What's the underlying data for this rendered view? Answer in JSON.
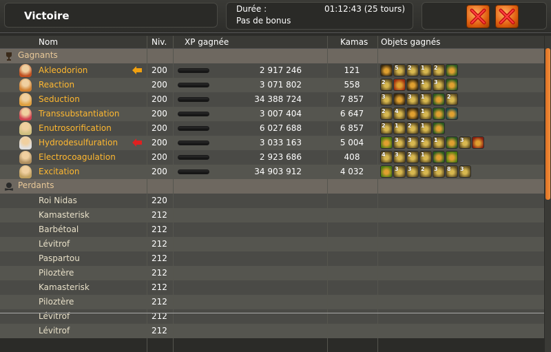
{
  "header": {
    "title": "Victoire",
    "duree_label": "Durée :",
    "duree_value": "01:12:43 (25 tours)",
    "bonus": "Pas de bonus"
  },
  "columns": {
    "nom": "Nom",
    "niv": "Niv.",
    "xp": "XP gagnée",
    "kamas": "Kamas",
    "objets": "Objets gagnés"
  },
  "sections": {
    "gagnants": "Gagnants",
    "perdants": "Perdants"
  },
  "colors": {
    "winner_name": "#ffb830",
    "accent_orange": "#e07020"
  },
  "winners": [
    {
      "name": "Akleodorion",
      "niv": "200",
      "xp": "2 917 246",
      "kamas": "121",
      "arrow": "orange",
      "items": [
        "key",
        "5",
        "2",
        "1",
        "2",
        "dofus"
      ]
    },
    {
      "name": "Reaction",
      "niv": "200",
      "xp": "3 071 802",
      "kamas": "558",
      "items": [
        "2",
        "fire",
        "key",
        "1",
        "3",
        "dofus"
      ]
    },
    {
      "name": "Seduction",
      "niv": "200",
      "xp": "34 388 724",
      "kamas": "7 857",
      "items": [
        "3",
        "key",
        "3",
        "1",
        "dofus",
        "2"
      ]
    },
    {
      "name": "Transsubstantiation",
      "niv": "200",
      "xp": "3 007 404",
      "kamas": "6 647",
      "items": [
        "2",
        "4",
        "key",
        "1",
        "dofus",
        "horn"
      ]
    },
    {
      "name": "Enutrosorification",
      "niv": "200",
      "xp": "6 027 688",
      "kamas": "6 857",
      "items": [
        "2",
        "1",
        "2",
        "1",
        "dofus"
      ]
    },
    {
      "name": "Hydrodesulfuration",
      "niv": "200",
      "xp": "3 033 163",
      "kamas": "5 004",
      "arrow": "red",
      "items": [
        "green",
        "3",
        "3",
        "2",
        "1",
        "dofus",
        "3",
        "red"
      ]
    },
    {
      "name": "Electrocoagulation",
      "niv": "200",
      "xp": "2 923 686",
      "kamas": "408",
      "items": [
        "4",
        "3",
        "2",
        "1",
        "dofus",
        "green"
      ]
    },
    {
      "name": "Excitation",
      "niv": "200",
      "xp": "34 903 912",
      "kamas": "4 032",
      "items": [
        "green",
        "3",
        "3",
        "2",
        "3",
        "8",
        "3"
      ]
    }
  ],
  "losers": [
    {
      "name": "Roi Nidas",
      "niv": "220"
    },
    {
      "name": "Kamasterisk",
      "niv": "212"
    },
    {
      "name": "Barbétoal",
      "niv": "212"
    },
    {
      "name": "Lévitrof",
      "niv": "212"
    },
    {
      "name": "Paspartou",
      "niv": "212"
    },
    {
      "name": "Piloztère",
      "niv": "212"
    },
    {
      "name": "Kamasterisk",
      "niv": "212"
    },
    {
      "name": "Piloztère",
      "niv": "212"
    },
    {
      "name": "Lévitrof",
      "niv": "212"
    },
    {
      "name": "Lévitrof",
      "niv": "212"
    }
  ]
}
